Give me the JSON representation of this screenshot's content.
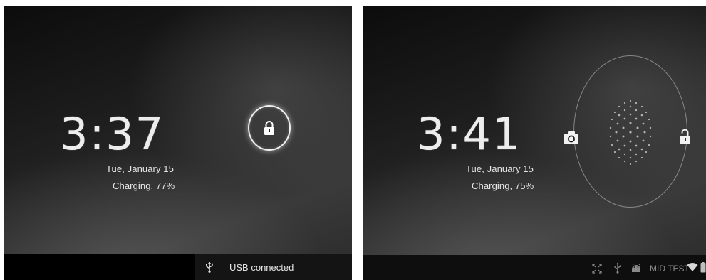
{
  "left_screen": {
    "time": "3:37",
    "date": "Tue, January 15",
    "charging": "Charging, 77%",
    "lock_icon": "lock-icon",
    "status_bar": {
      "usb_icon": "usb-icon",
      "notification": "USB connected"
    }
  },
  "right_screen": {
    "time": "3:41",
    "date": "Tue, January 15",
    "charging": "Charging, 75%",
    "camera_icon": "camera-icon",
    "unlock_icon": "unlocked-padlock-icon",
    "status_bar": {
      "icons": [
        "expand-icon",
        "usb-icon",
        "android-icon",
        "wifi-icon",
        "battery-icon"
      ],
      "label": "MID TEST"
    }
  }
}
